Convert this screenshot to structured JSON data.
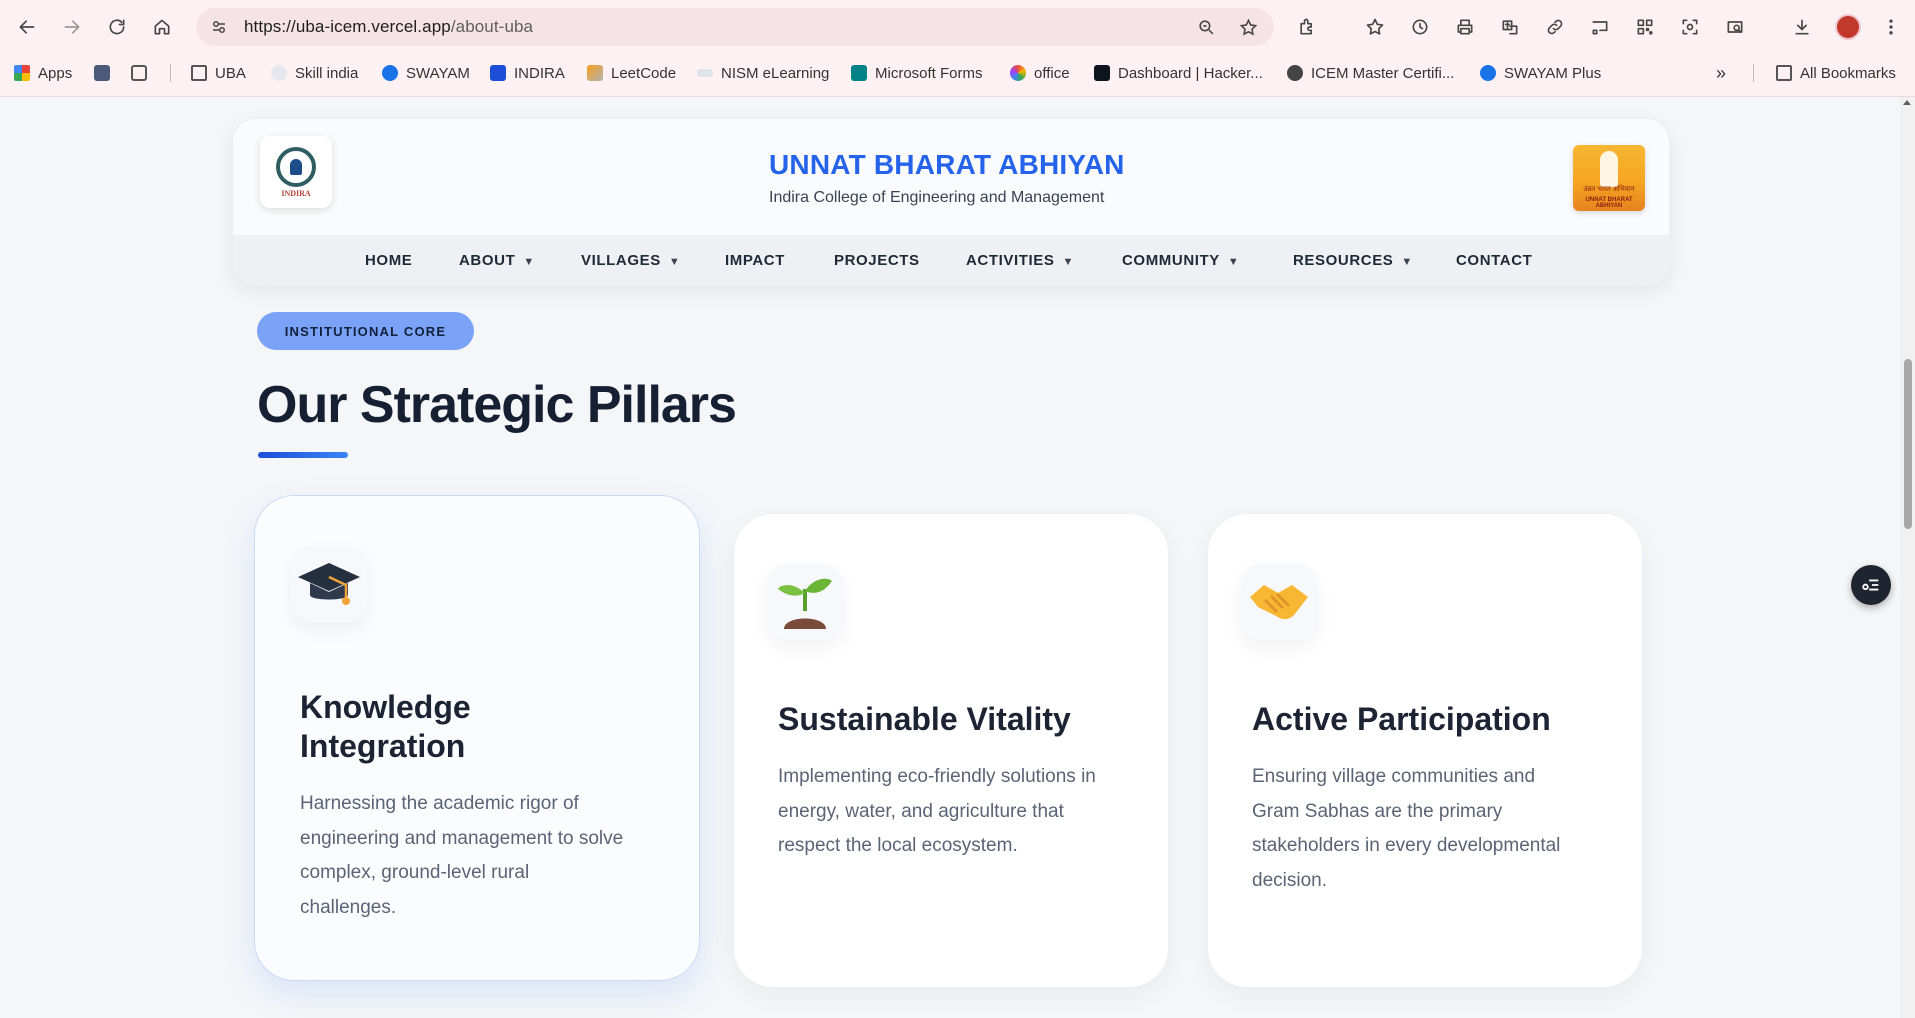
{
  "browser": {
    "url_host": "https://uba-icem.vercel.app",
    "url_path": "/about-uba"
  },
  "bookmarks": [
    {
      "label": "Apps",
      "icon": "apps-grid-icon"
    },
    {
      "label": "",
      "icon": "square-app-icon"
    },
    {
      "label": "",
      "icon": "tab-groups-icon"
    },
    {
      "label": "UBA",
      "icon": "folder-icon"
    },
    {
      "label": "Skill india",
      "icon": "skill-india-icon"
    },
    {
      "label": "SWAYAM",
      "icon": "swayam-icon"
    },
    {
      "label": "INDIRA",
      "icon": "indira-icon"
    },
    {
      "label": "LeetCode",
      "icon": "leetcode-icon"
    },
    {
      "label": "NISM eLearning",
      "icon": "nism-icon"
    },
    {
      "label": "Microsoft Forms",
      "icon": "forms-icon"
    },
    {
      "label": "office",
      "icon": "office-icon"
    },
    {
      "label": "Dashboard | Hacker...",
      "icon": "hackerrank-icon"
    },
    {
      "label": "ICEM Master Certifi...",
      "icon": "globe-icon"
    },
    {
      "label": "SWAYAM Plus",
      "icon": "swayam-icon"
    },
    {
      "label": "All Bookmarks",
      "icon": "folder-icon"
    }
  ],
  "header": {
    "title": "UNNAT BHARAT ABHIYAN",
    "subtitle": "Indira College of Engineering and Management",
    "logo_left_text": "INDIRA",
    "logo_right_text_hi": "उन्नत भारत अभियान",
    "logo_right_text_en": "UNNAT BHARAT ABHIYAN"
  },
  "nav": [
    {
      "label": "HOME",
      "dropdown": false
    },
    {
      "label": "ABOUT",
      "dropdown": true
    },
    {
      "label": "VILLAGES",
      "dropdown": true
    },
    {
      "label": "IMPACT",
      "dropdown": false
    },
    {
      "label": "PROJECTS",
      "dropdown": false
    },
    {
      "label": "ACTIVITIES",
      "dropdown": true
    },
    {
      "label": "COMMUNITY",
      "dropdown": true
    },
    {
      "label": "RESOURCES",
      "dropdown": true
    },
    {
      "label": "CONTACT",
      "dropdown": false
    }
  ],
  "section": {
    "badge": "INSTITUTIONAL CORE",
    "title": "Our Strategic Pillars"
  },
  "pillars": [
    {
      "icon": "graduation-cap-icon",
      "title_line1": "Knowledge",
      "title_line2": "Integration",
      "text_lines": [
        "Harnessing the academic rigor of",
        "engineering and management to solve",
        "complex, ground-level rural",
        "challenges."
      ]
    },
    {
      "icon": "seedling-icon",
      "title_line1": "Sustainable Vitality",
      "title_line2": "",
      "text_lines": [
        "Implementing eco-friendly solutions in",
        "energy, water, and agriculture that",
        "respect the local ecosystem.",
        ""
      ]
    },
    {
      "icon": "handshake-icon",
      "title_line1": "Active Participation",
      "title_line2": "",
      "text_lines": [
        "Ensuring village communities and",
        "Gram Sabhas are the primary",
        "stakeholders in every developmental",
        "decision."
      ]
    }
  ],
  "colors": {
    "brand_blue": "#2563eb",
    "badge_bg": "#7aa2f7",
    "title_dark": "#162033",
    "browser_chrome": "#fdf1f3"
  }
}
